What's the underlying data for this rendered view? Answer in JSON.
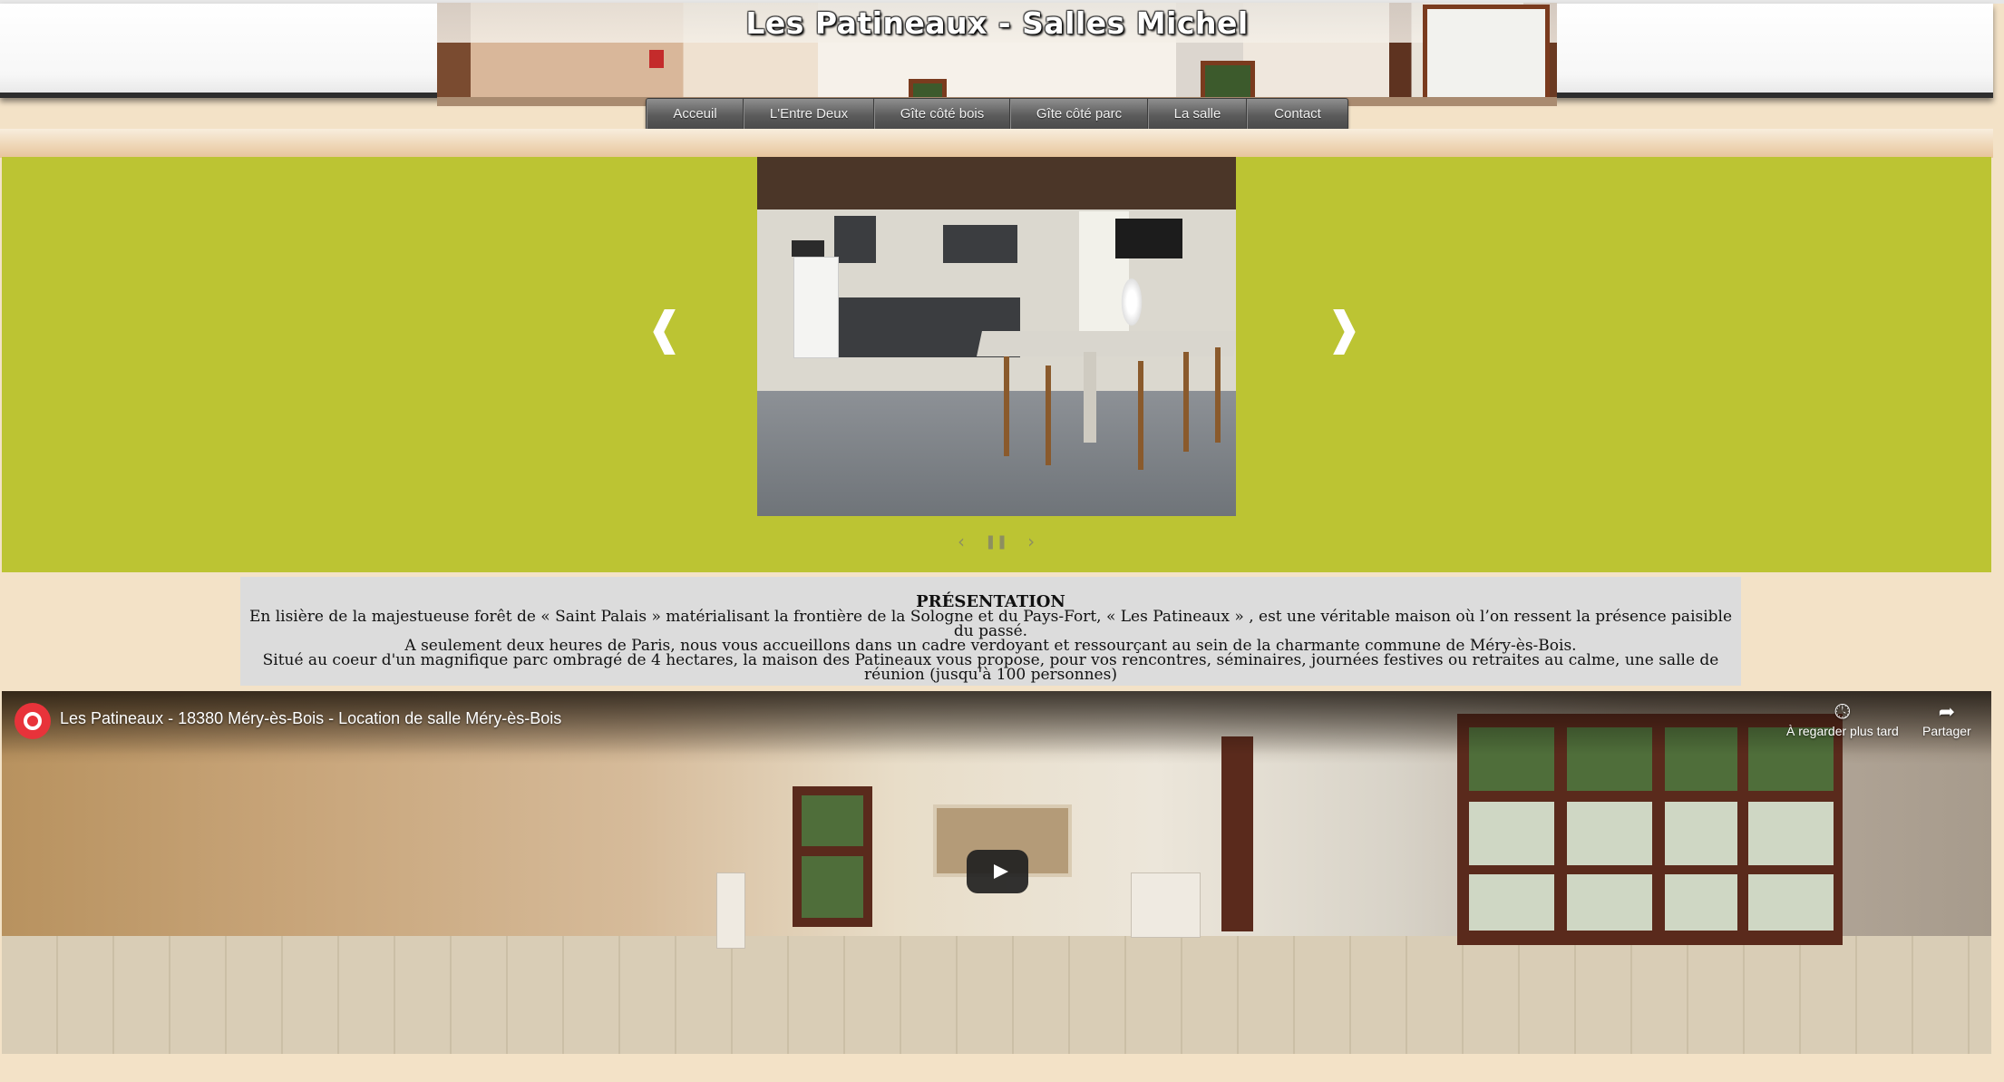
{
  "header": {
    "site_title": "Les Patineaux - Salles Michel"
  },
  "nav": {
    "items": [
      {
        "label": "Acceuil"
      },
      {
        "label": "L'Entre Deux"
      },
      {
        "label": "Gîte côté bois"
      },
      {
        "label": "Gîte côté parc"
      },
      {
        "label": "La salle"
      },
      {
        "label": "Contact"
      }
    ]
  },
  "slider": {
    "prev_arrow": "❰",
    "next_arrow": "❱",
    "controls": {
      "prev": "‹",
      "pause": "❚❚",
      "next": "›"
    },
    "background_color": "#bcc433"
  },
  "presentation": {
    "title": "PRÉSENTATION",
    "lines": [
      "En lisière de la majestueuse forêt de « Saint Palais » matérialisant la frontière de la Sologne et du Pays-Fort, « Les Patineaux » , est une véritable maison où l’on ressent la présence paisible du passé.",
      "A seulement deux heures de Paris, nous vous accueillons dans un cadre verdoyant et ressourçant au sein de la charmante commune de Méry-ès-Bois.",
      "Situé au coeur d'un magnifique parc ombragé de 4 hectares, la maison des Patineaux vous propose, pour vos rencontres, séminaires, journées festives ou retraites au calme, une salle de réunion (jusqu'à 100 personnes)"
    ]
  },
  "video": {
    "title": "Les Patineaux - 18380 Méry-ès-Bois - Location de salle Méry-ès-Bois",
    "watch_later_label": "À regarder plus tard",
    "share_label": "Partager",
    "icons": {
      "watch_later": "clock-icon",
      "share": "share-icon",
      "play": "play-icon"
    }
  },
  "colors": {
    "page_background": "#f3e2c7",
    "nav_background": "#5b5b5b",
    "presentation_background": "#dcdcdc"
  }
}
